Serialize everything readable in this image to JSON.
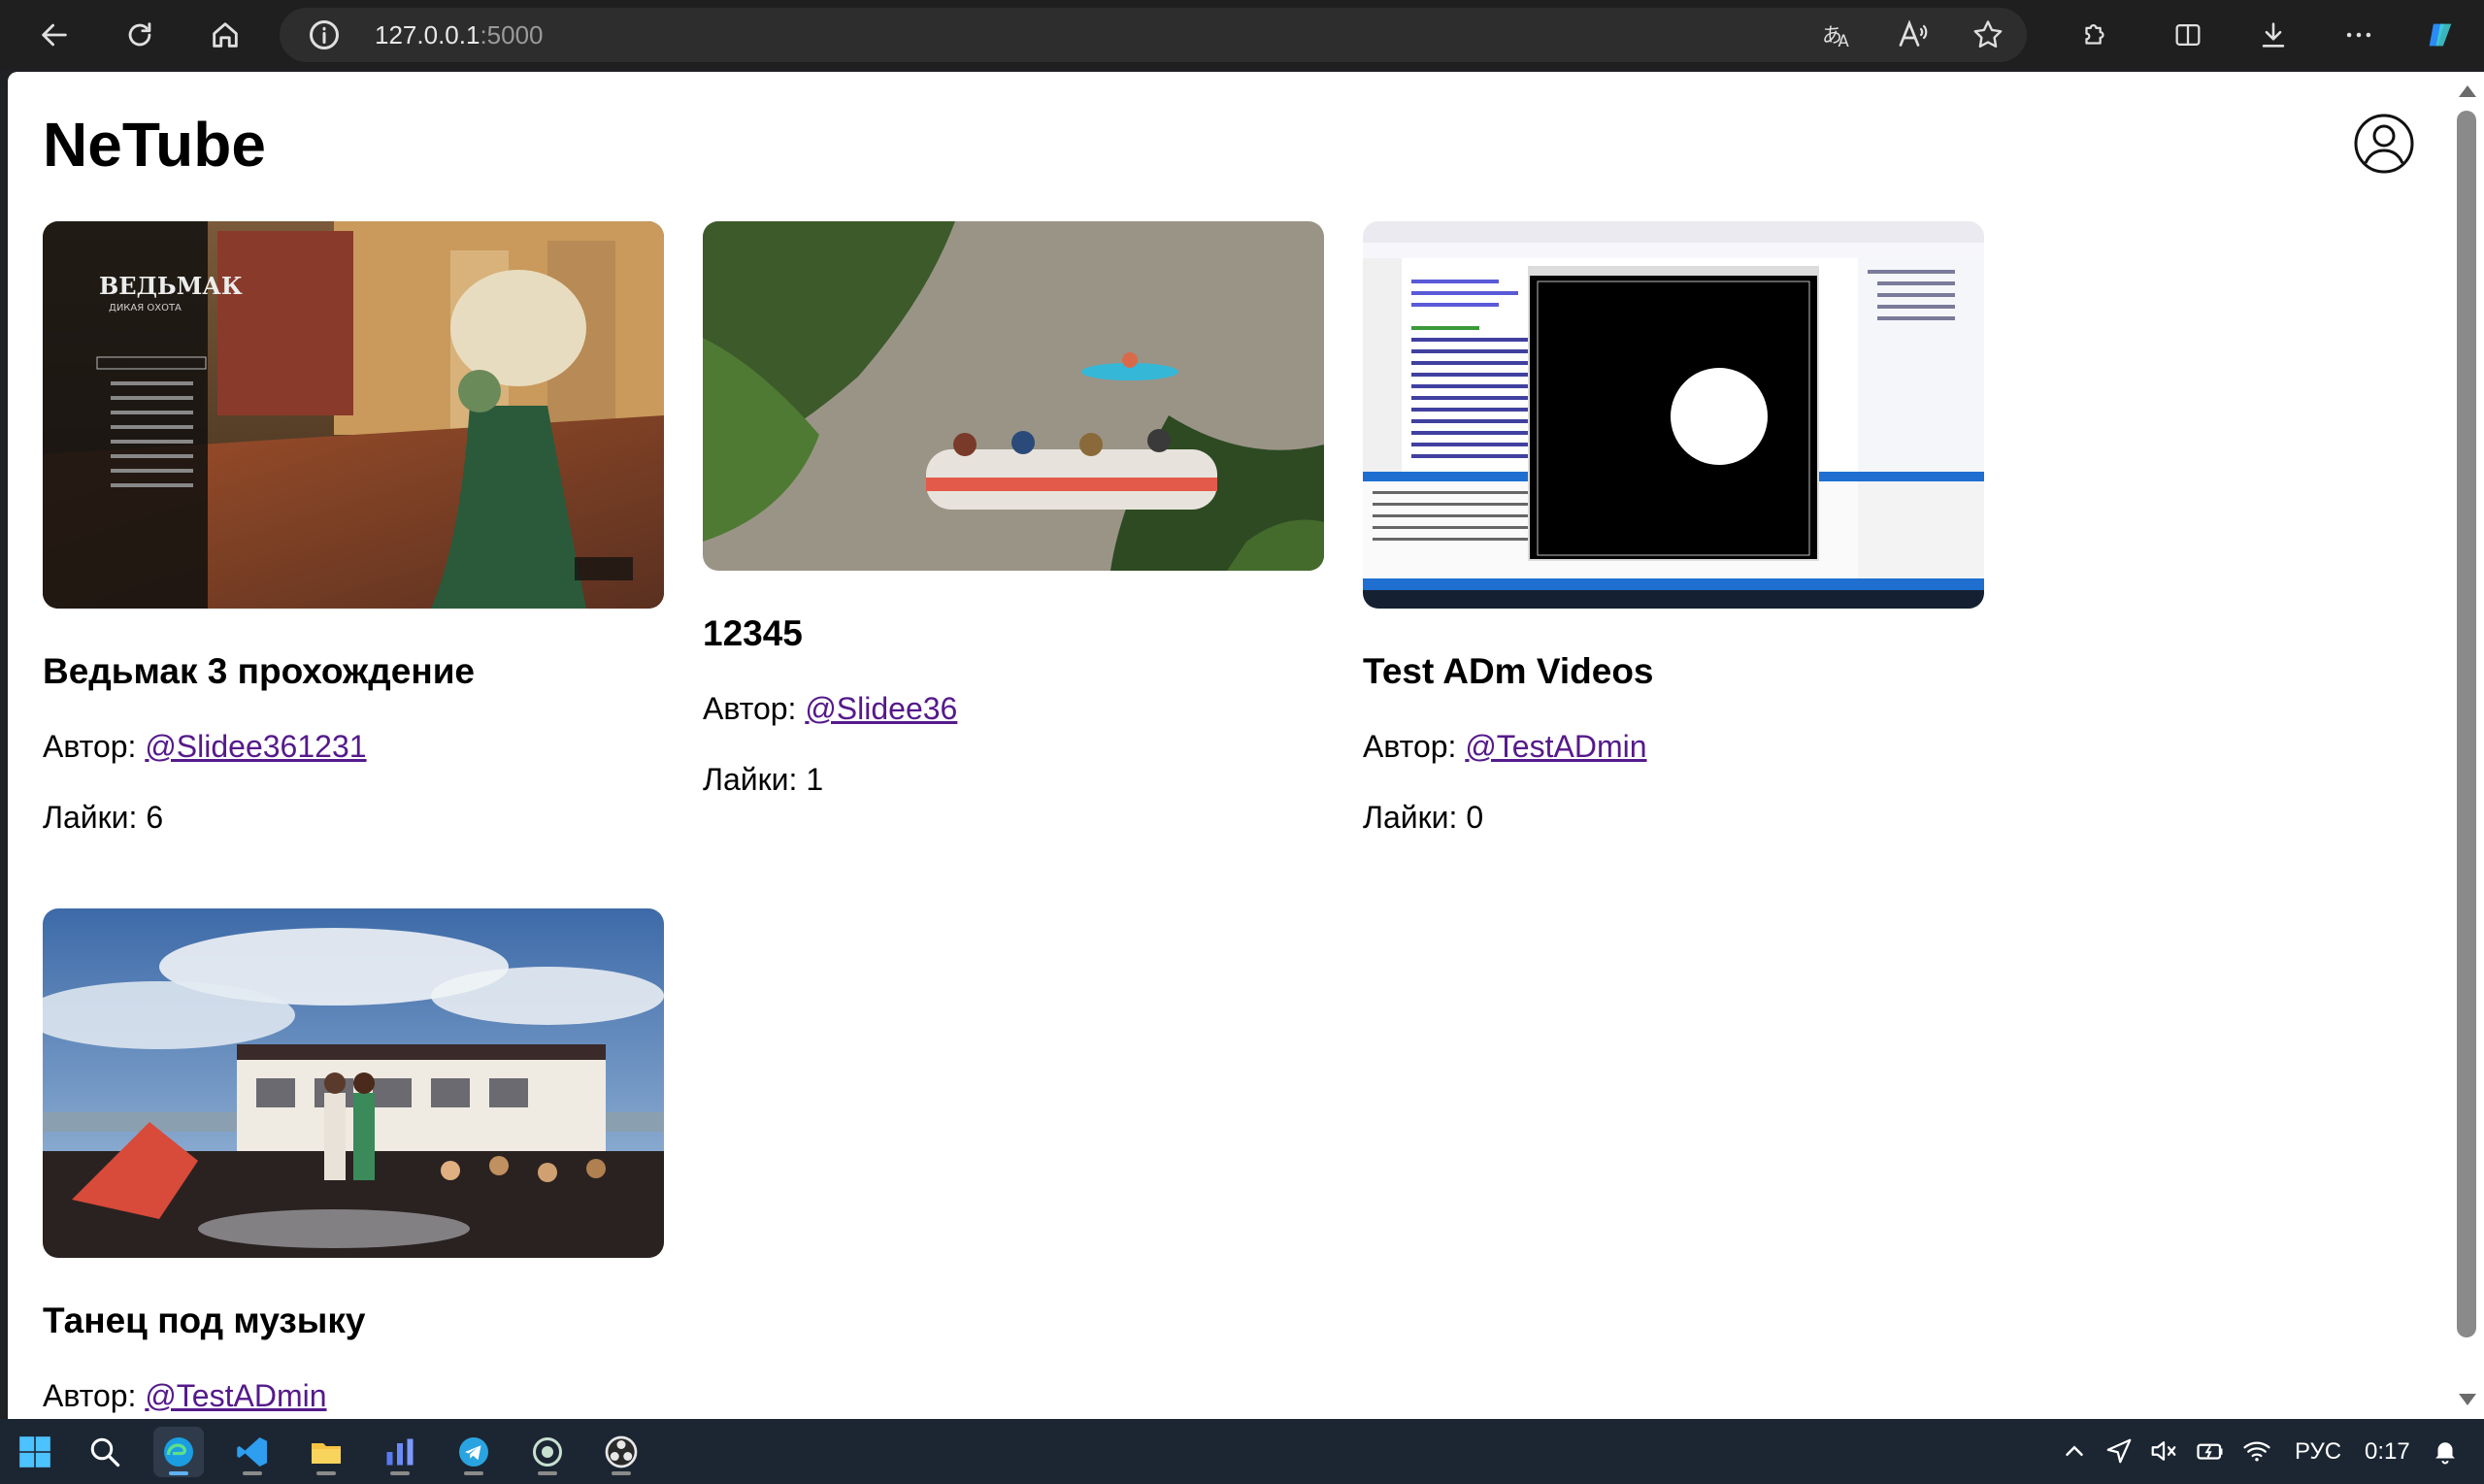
{
  "browser": {
    "address_host": "127.0.0.1",
    "address_port": ":5000"
  },
  "site": {
    "title": "NeTube"
  },
  "videos": [
    {
      "title": "Ведьмак 3 прохождение",
      "author_label": "Автор: ",
      "author_handle": "@Slidee361231",
      "likes": "Лайки: 6",
      "thumb_logo": "ВЕДЬМАК",
      "thumb_sub": "ДИКАЯ ОХОТА"
    },
    {
      "title": "12345",
      "author_label": "Автор: ",
      "author_handle": "@Slidee36",
      "likes": "Лайки: 1"
    },
    {
      "title": "Test ADm Videos",
      "author_label": "Автор: ",
      "author_handle": "@TestADmin",
      "likes": "Лайки: 0"
    },
    {
      "title": "Танец под музыку",
      "author_label": "Автор: ",
      "author_handle": "@TestADmin",
      "likes": ""
    }
  ],
  "taskbar": {
    "language": "РУС",
    "time": "0:17"
  },
  "icons": {
    "back": "back-arrow-icon",
    "reload": "reload-icon",
    "home": "home-icon",
    "info": "info-icon",
    "avatar": "user-avatar-icon"
  },
  "colors": {
    "link": "#551a8b",
    "browser_bg": "#1f1f1f",
    "taskbar_bg": "#1c2633"
  }
}
